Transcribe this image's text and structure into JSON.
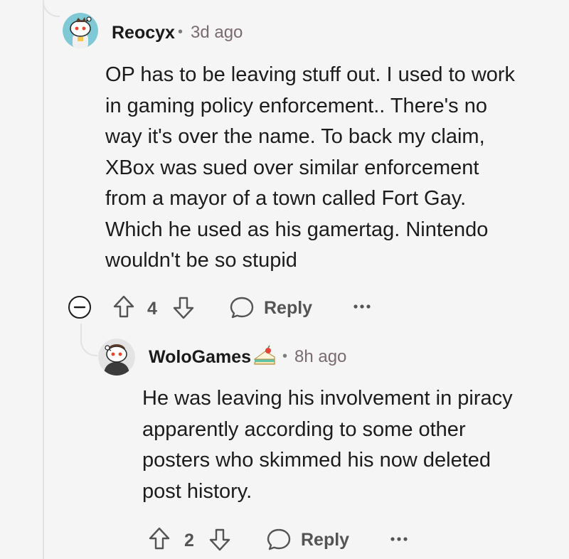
{
  "comments": [
    {
      "username": "Reocyx",
      "separator": "•",
      "time": "3d ago",
      "body_lines": [
        "OP has to be leaving stuff out. I used to work",
        "in gaming policy enforcement.. There's no",
        "way it's over the name. To back my claim,",
        "XBox was sued over similar enforcement",
        "from a mayor of a town called Fort Gay.",
        "Which he used as his gamertag. Nintendo",
        "wouldn't be so stupid"
      ],
      "score": "4",
      "reply_label": "Reply",
      "more_label": "•••",
      "icons": [
        "avatar",
        "collapse-icon",
        "upvote-icon",
        "downvote-icon",
        "speech-bubble-icon",
        "more-icon"
      ]
    },
    {
      "username": "WoloGames",
      "separator": "•",
      "time": "8h ago",
      "body_lines": [
        "He was leaving his involvement in piracy",
        "apparently according to some other",
        "posters who skimmed his now deleted",
        "post history."
      ],
      "score": "2",
      "reply_label": "Reply",
      "more_label": "•••",
      "icons": [
        "avatar",
        "cake-day-icon",
        "upvote-icon",
        "downvote-icon",
        "speech-bubble-icon",
        "more-icon"
      ]
    }
  ],
  "colors": {
    "background": "#f5f5f5",
    "text": "#1c1c1c",
    "muted": "#545454",
    "time": "#7a6a71",
    "thread_line": "#e2e2e2"
  }
}
